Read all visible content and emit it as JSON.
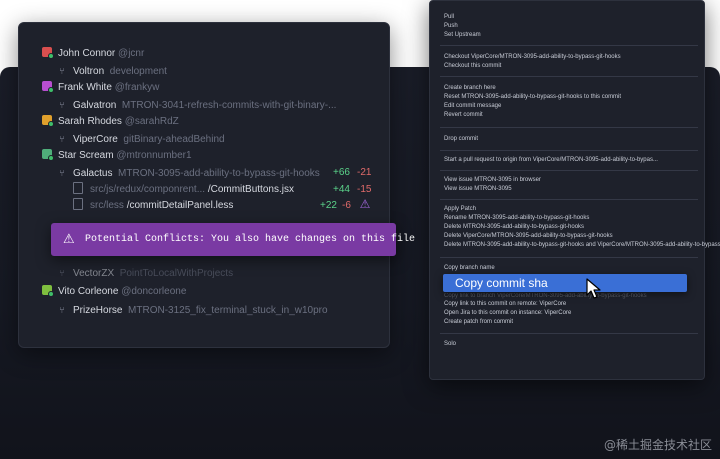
{
  "commit_list": {
    "rows": [
      {
        "type": "user",
        "name": "John Connor",
        "handle": "@jcnr",
        "avatar_color": "#d94f4f"
      },
      {
        "type": "branch",
        "repo": "Voltron",
        "branch": "development"
      },
      {
        "type": "user",
        "name": "Frank White",
        "handle": "@frankyw",
        "avatar_color": "#b84fd0"
      },
      {
        "type": "branch",
        "repo": "Galvatron",
        "branch": "MTRON-3041-refresh-commits-with-git-binary-..."
      },
      {
        "type": "user",
        "name": "Sarah Rhodes",
        "handle": "@sarahRdZ",
        "avatar_color": "#e0a02c"
      },
      {
        "type": "branch",
        "repo": "ViperCore",
        "branch": "gitBinary-aheadBehind"
      },
      {
        "type": "user",
        "name": "Star Scream",
        "handle": "@mtronnumber1",
        "avatar_color": "#4fae7a"
      },
      {
        "type": "branch",
        "repo": "Galactus",
        "branch": "MTRON-3095-add-ability-to-bypass-git-hooks",
        "added": "+66",
        "removed": "-21"
      },
      {
        "type": "file",
        "dir": "src/js/redux/componrent...",
        "file": "/CommitButtons.jsx",
        "added": "+44",
        "removed": "-15"
      },
      {
        "type": "file",
        "dir": "src/less",
        "file": "/commitDetailPanel.less",
        "added": "+22",
        "removed": "-6"
      },
      {
        "type": "branch",
        "repo": "VectorZX",
        "branch": "PointToLocalWithProjects"
      },
      {
        "type": "user",
        "name": "Vito Corleone",
        "handle": "@doncorleone",
        "avatar_color": "#7fbf3f"
      },
      {
        "type": "branch",
        "repo": "PrizeHorse",
        "branch": "MTRON-3125_fix_terminal_stuck_in_w10pro"
      }
    ]
  },
  "conflict_tooltip": {
    "icon": "warning-icon",
    "text": "Potential Conflicts: You also have changes on this file"
  },
  "context_menu": {
    "groups": [
      [
        "Pull",
        "Push",
        "Set Upstream"
      ],
      [
        "Checkout ViperCore/MTRON-3095-add-ability-to-bypass-git-hooks",
        "Checkout this commit"
      ],
      [
        "Create branch here",
        "Reset MTRON-3095-add-ability-to-bypass-git-hooks to this commit",
        "Edit commit message",
        "Revert commit"
      ],
      [
        "Drop commit"
      ],
      [
        "Start a pull request to origin from ViperCore/MTRON-3095-add-ability-to-bypas..."
      ],
      [
        "View issue MTRON-3095 in browser",
        "View issue MTRON-3095"
      ],
      [
        "Apply Patch",
        "Rename MTRON-3095-add-ability-to-bypass-git-hooks",
        "Delete MTRON-3095-add-ability-to-bypass-git-hooks",
        "Delete ViperCore/MTRON-3095-add-ability-to-bypass-git-hooks",
        "Delete MTRON-3095-add-ability-to-bypass-git-hooks and ViperCore/MTRON-3095-add-ability-to-bypass-..."
      ],
      [
        "Copy branch name",
        "Copy commit sha",
        "Copy link to branch ViperCore/MTRON-3095-add-ability-to-bypass-git-hooks",
        "Copy link to this commit on remote: ViperCore",
        "Open Jira to this commit on instance: ViperCore",
        "Create patch from commit"
      ],
      [
        "Solo"
      ]
    ],
    "highlighted": "Copy commit sha"
  },
  "watermark": "@稀土掘金技术社区"
}
